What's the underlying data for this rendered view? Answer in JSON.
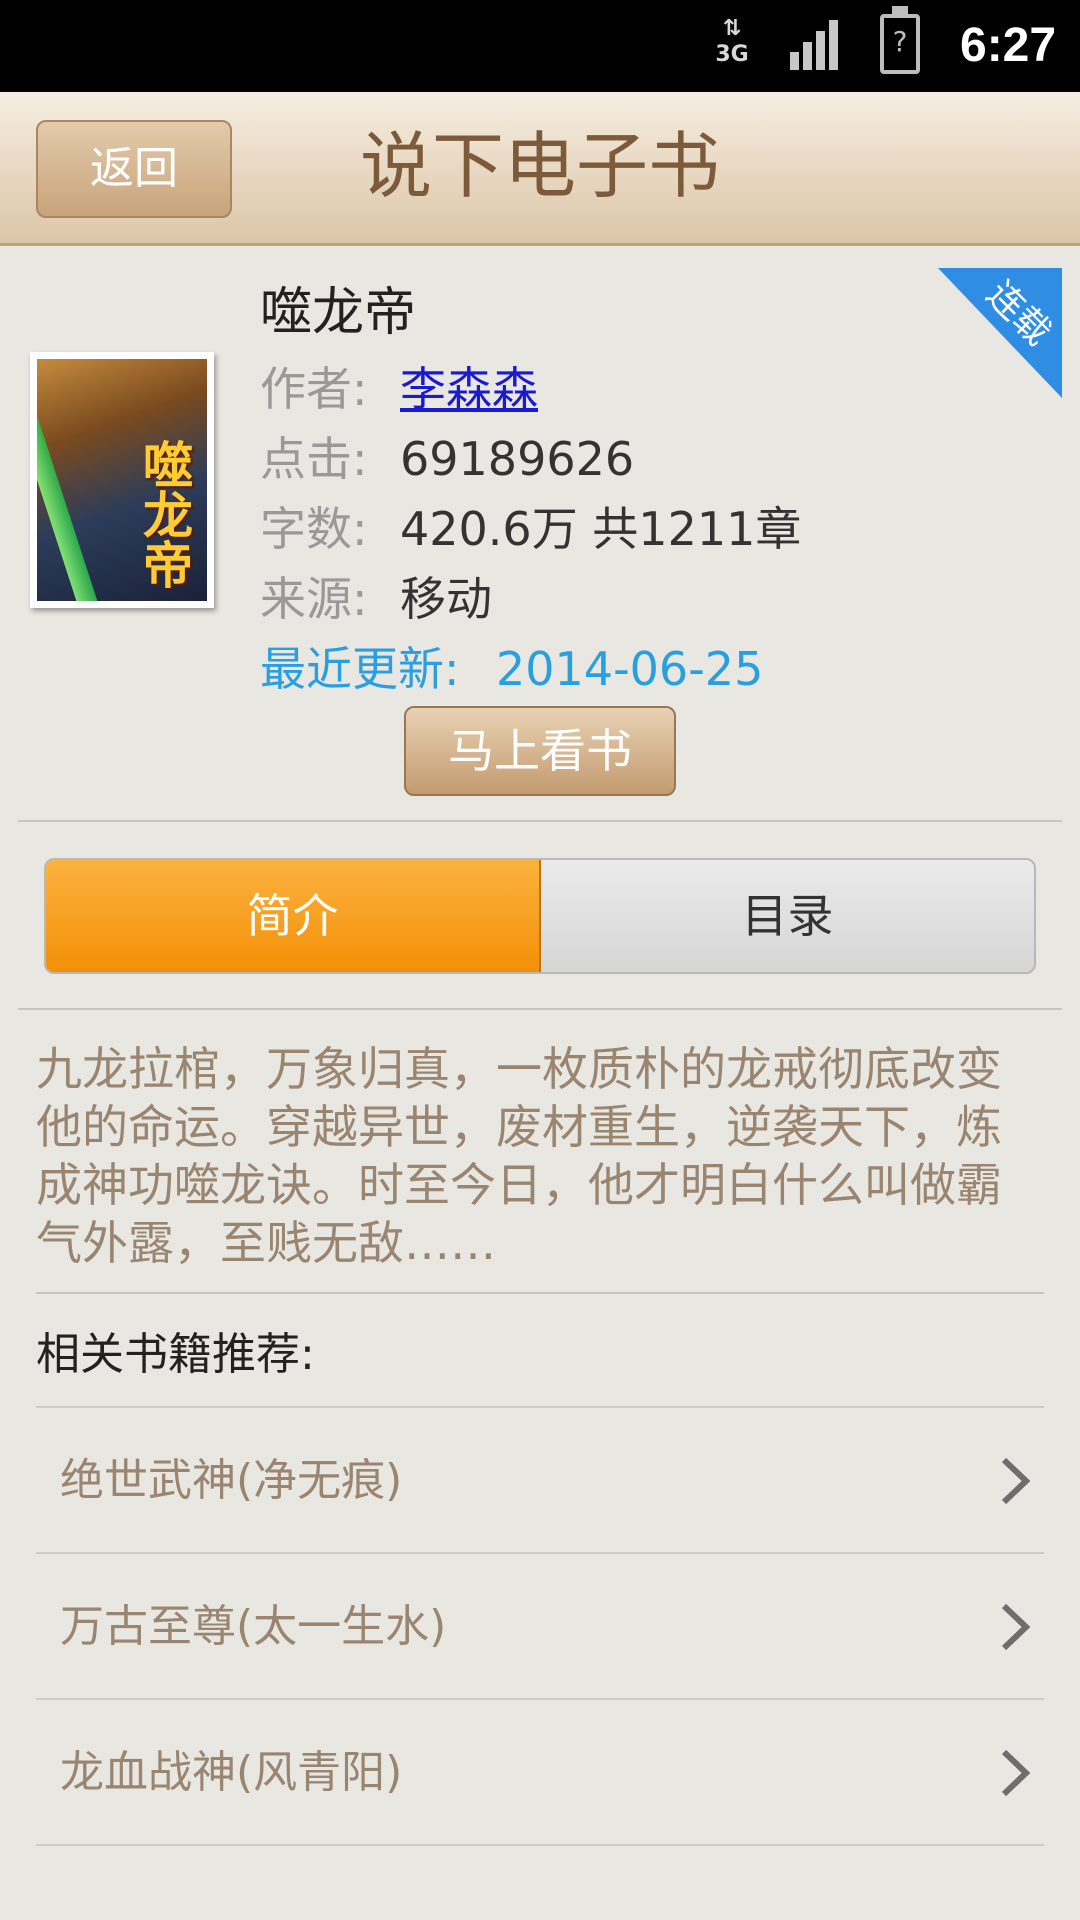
{
  "status_bar": {
    "network": "3G",
    "battery": "?",
    "time": "6:27"
  },
  "header": {
    "back_label": "返回",
    "title": "说下电子书"
  },
  "book": {
    "name": "噬龙帝",
    "cover_title": "噬龙帝",
    "status_ribbon": "连载",
    "author_label": "作者:",
    "author": "李森森",
    "clicks_label": "点击:",
    "clicks": "69189626",
    "words_label": "字数:",
    "words": "420.6万 共1211章",
    "source_label": "来源:",
    "source": "移动",
    "updated_label": "最近更新:",
    "updated": "2014-06-25",
    "read_button": "马上看书"
  },
  "tabs": [
    {
      "label": "简介",
      "active": true
    },
    {
      "label": "目录",
      "active": false
    }
  ],
  "synopsis": "九龙拉棺，万象归真，一枚质朴的龙戒彻底改变他的命运。穿越异世，废材重生，逆袭天下，炼成神功噬龙诀。时至今日，他才明白什么叫做霸气外露，至贱无敌……",
  "recommendations": {
    "heading": "相关书籍推荐:",
    "items": [
      {
        "label": "绝世武神(净无痕)"
      },
      {
        "label": "万古至尊(太一生水)"
      },
      {
        "label": "龙血战神(风青阳)"
      }
    ]
  },
  "colors": {
    "accent_orange": "#f39007",
    "link_blue": "#1a1ad0",
    "update_blue": "#2a9fe0",
    "ribbon_blue": "#2f8ee3",
    "title_brown": "#7c5a3a"
  }
}
